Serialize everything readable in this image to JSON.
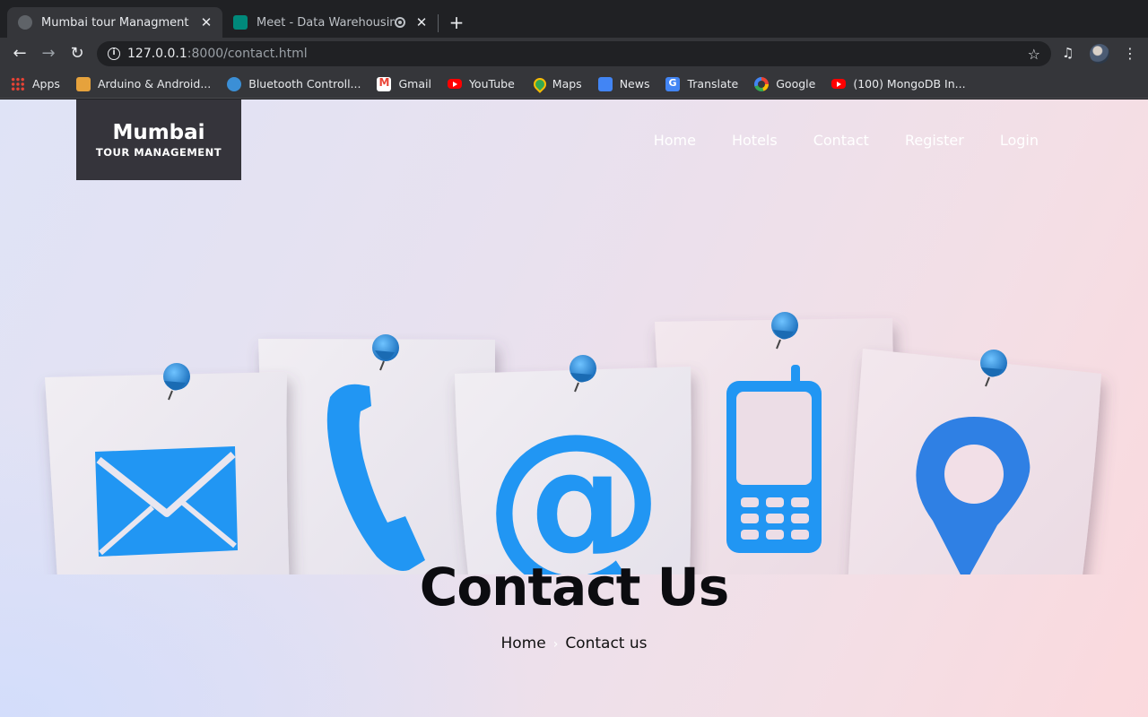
{
  "browser": {
    "tabs": [
      {
        "title": "Mumbai tour Managment",
        "active": true,
        "close": "✕"
      },
      {
        "title": "Meet - Data Warehousing a",
        "active": false,
        "close": "✕"
      }
    ],
    "new_tab": "+",
    "url_host": "127.0.0.1",
    "url_rest": ":8000/contact.html",
    "bookmarks": [
      {
        "label": "Apps",
        "icon": "apps-grid-icon"
      },
      {
        "label": "Arduino & Android...",
        "icon": "arduino-icon"
      },
      {
        "label": "Bluetooth Controll...",
        "icon": "globe-icon"
      },
      {
        "label": "Gmail",
        "icon": "gmail-icon"
      },
      {
        "label": "YouTube",
        "icon": "youtube-icon"
      },
      {
        "label": "Maps",
        "icon": "maps-icon"
      },
      {
        "label": "News",
        "icon": "news-icon"
      },
      {
        "label": "Translate",
        "icon": "translate-icon"
      },
      {
        "label": "Google",
        "icon": "google-icon"
      },
      {
        "label": "(100) MongoDB In...",
        "icon": "youtube-icon"
      }
    ]
  },
  "site": {
    "logo_main": "Mumbai",
    "logo_sub": "TOUR MANAGEMENT",
    "nav": [
      "Home",
      "Hotels",
      "Contact",
      "Register",
      "Login"
    ]
  },
  "hero": {
    "title": "Contact Us",
    "breadcrumb": [
      "Home",
      "Contact us"
    ],
    "note_icons": [
      "envelope-icon",
      "phone-handset-icon",
      "at-sign-icon",
      "mobile-phone-icon",
      "location-pin-icon"
    ],
    "accent_color": "#2196f3"
  }
}
